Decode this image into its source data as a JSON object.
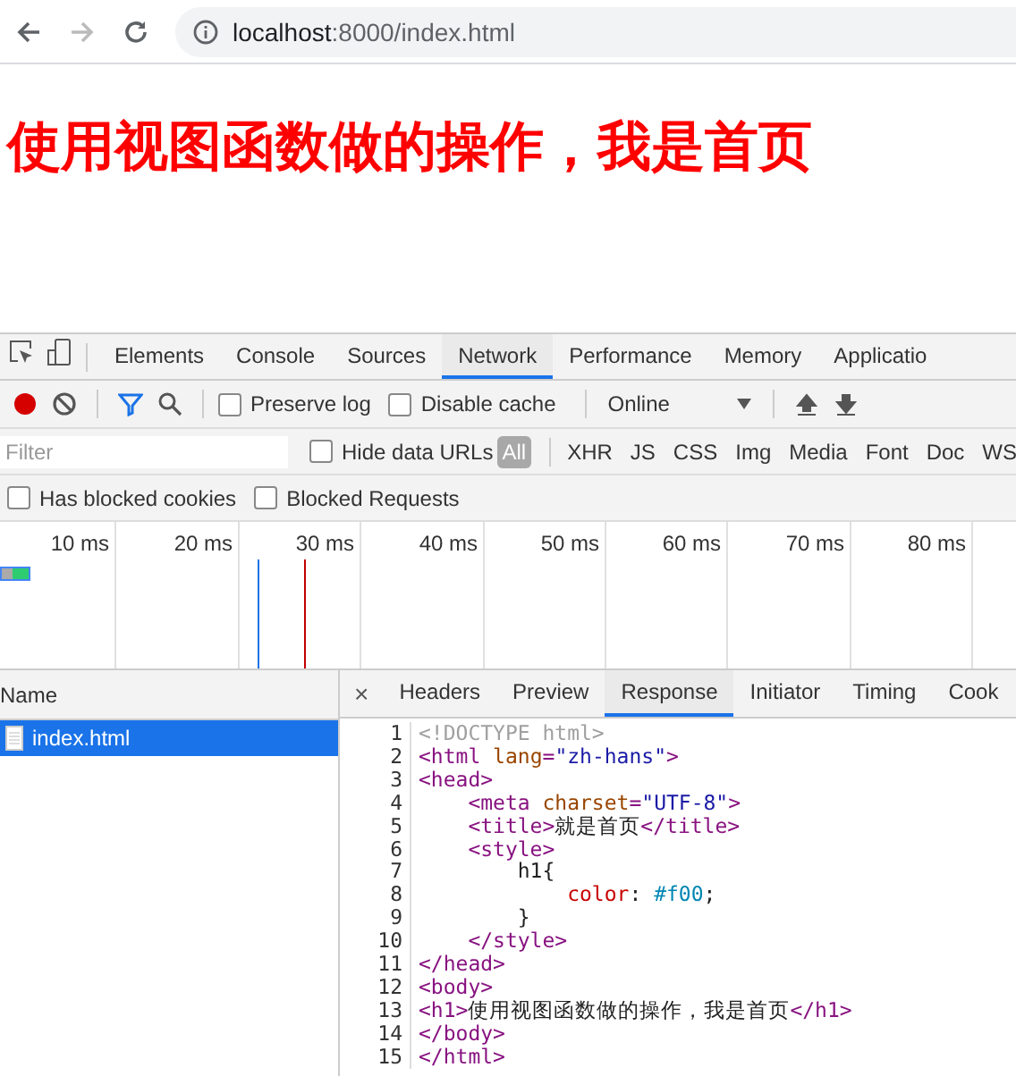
{
  "browser": {
    "url_host": "localhost",
    "url_rest": ":8000/index.html"
  },
  "page": {
    "heading": "使用视图函数做的操作，我是首页"
  },
  "devtools": {
    "tabs": [
      {
        "label": "Elements",
        "selected": false
      },
      {
        "label": "Console",
        "selected": false
      },
      {
        "label": "Sources",
        "selected": false
      },
      {
        "label": "Network",
        "selected": true
      },
      {
        "label": "Performance",
        "selected": false
      },
      {
        "label": "Memory",
        "selected": false
      },
      {
        "label": "Applicatio",
        "selected": false
      }
    ],
    "toolbar": {
      "recording": true,
      "preserve_log": {
        "label": "Preserve log",
        "checked": false
      },
      "disable_cache": {
        "label": "Disable cache",
        "checked": false
      },
      "throttling": "Online"
    },
    "filter": {
      "placeholder": "Filter",
      "hide_data_urls": {
        "label": "Hide data URLs",
        "checked": false
      },
      "types": [
        {
          "label": "All",
          "selected": true
        },
        {
          "label": "XHR",
          "selected": false
        },
        {
          "label": "JS",
          "selected": false
        },
        {
          "label": "CSS",
          "selected": false
        },
        {
          "label": "Img",
          "selected": false
        },
        {
          "label": "Media",
          "selected": false
        },
        {
          "label": "Font",
          "selected": false
        },
        {
          "label": "Doc",
          "selected": false
        },
        {
          "label": "WS",
          "selected": false
        }
      ],
      "extra": [
        {
          "label": "Has blocked cookies",
          "checked": false
        },
        {
          "label": "Blocked Requests",
          "checked": false
        }
      ]
    },
    "timeline": {
      "ticks": [
        "10 ms",
        "20 ms",
        "30 ms",
        "40 ms",
        "50 ms",
        "60 ms",
        "70 ms",
        "80 ms"
      ]
    },
    "requests": {
      "column": "Name",
      "items": [
        {
          "name": "index.html",
          "selected": true
        }
      ]
    },
    "detail_tabs": [
      {
        "label": "Headers",
        "selected": false
      },
      {
        "label": "Preview",
        "selected": false
      },
      {
        "label": "Response",
        "selected": true
      },
      {
        "label": "Initiator",
        "selected": false
      },
      {
        "label": "Timing",
        "selected": false
      },
      {
        "label": "Cook",
        "selected": false
      }
    ],
    "close_label": "×",
    "code": [
      {
        "number": "1",
        "tokens": [
          {
            "kind": "comment",
            "text": "<!DOCTYPE html>"
          }
        ]
      },
      {
        "number": "2",
        "tokens": [
          {
            "kind": "tag",
            "text": "<html"
          },
          {
            "kind": "attr",
            "text": " lang"
          },
          {
            "kind": "tag",
            "text": "="
          },
          {
            "kind": "value",
            "text": "\"zh-hans\""
          },
          {
            "kind": "tag",
            "text": ">"
          }
        ]
      },
      {
        "number": "3",
        "tokens": [
          {
            "kind": "tag",
            "text": "<head>"
          }
        ]
      },
      {
        "number": "4",
        "tokens": [
          {
            "kind": "tag",
            "text": "    <meta"
          },
          {
            "kind": "attr",
            "text": " charset"
          },
          {
            "kind": "tag",
            "text": "="
          },
          {
            "kind": "value",
            "text": "\"UTF-8\""
          },
          {
            "kind": "tag",
            "text": ">"
          }
        ]
      },
      {
        "number": "5",
        "tokens": [
          {
            "kind": "tag",
            "text": "    <title>"
          },
          {
            "kind": "text",
            "text": "就是首页"
          },
          {
            "kind": "tag",
            "text": "</title>"
          }
        ]
      },
      {
        "number": "6",
        "tokens": [
          {
            "kind": "tag",
            "text": "    <style>"
          }
        ]
      },
      {
        "number": "7",
        "tokens": [
          {
            "kind": "text",
            "text": "        h1{"
          }
        ]
      },
      {
        "number": "8",
        "tokens": [
          {
            "kind": "prop",
            "text": "            color"
          },
          {
            "kind": "text",
            "text": ": "
          },
          {
            "kind": "number",
            "text": "#f00"
          },
          {
            "kind": "text",
            "text": ";"
          }
        ]
      },
      {
        "number": "9",
        "tokens": [
          {
            "kind": "text",
            "text": "        }"
          }
        ]
      },
      {
        "number": "10",
        "tokens": [
          {
            "kind": "tag",
            "text": "    </style>"
          }
        ]
      },
      {
        "number": "11",
        "tokens": [
          {
            "kind": "tag",
            "text": "</head>"
          }
        ]
      },
      {
        "number": "12",
        "tokens": [
          {
            "kind": "tag",
            "text": "<body>"
          }
        ]
      },
      {
        "number": "13",
        "tokens": [
          {
            "kind": "tag",
            "text": "<h1>"
          },
          {
            "kind": "text",
            "text": "使用视图函数做的操作，我是首页"
          },
          {
            "kind": "tag",
            "text": "</h1>"
          }
        ]
      },
      {
        "number": "14",
        "tokens": [
          {
            "kind": "tag",
            "text": "</body>"
          }
        ]
      },
      {
        "number": "15",
        "tokens": [
          {
            "kind": "tag",
            "text": "</html>"
          }
        ]
      }
    ]
  }
}
